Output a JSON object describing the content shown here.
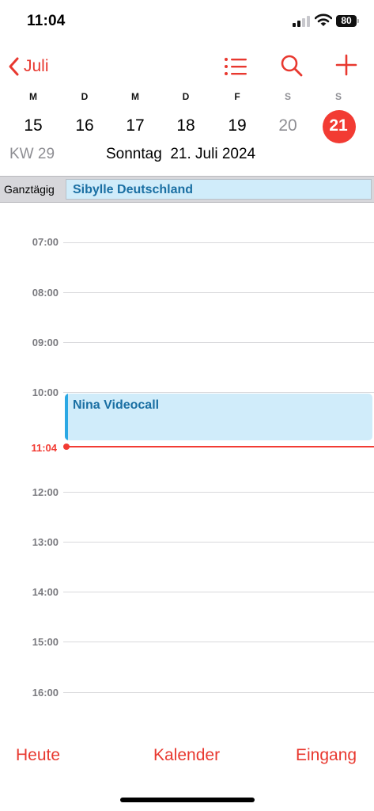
{
  "status_bar": {
    "time": "11:04",
    "battery": "80"
  },
  "nav": {
    "back_label": "Juli",
    "list_icon": "list-icon",
    "search_icon": "search-icon",
    "add_icon": "plus-icon"
  },
  "week": {
    "weekdays": [
      "M",
      "D",
      "M",
      "D",
      "F",
      "S",
      "S"
    ],
    "days": [
      "15",
      "16",
      "17",
      "18",
      "19",
      "20",
      "21"
    ],
    "selected_index": 6
  },
  "calendar_week": "KW 29",
  "selected_date": {
    "weekday": "Sonntag",
    "date": "21. Juli 2024"
  },
  "all_day": {
    "label": "Ganztägig",
    "event": "Sibylle Deutschland"
  },
  "hours": [
    "07:00",
    "08:00",
    "09:00",
    "10:00",
    "12:00",
    "13:00",
    "14:00",
    "15:00",
    "16:00"
  ],
  "current_time": "11:04",
  "events": [
    {
      "title": "Nina Videocall"
    }
  ],
  "colors": {
    "accent": "#f23b33",
    "event_fill": "#d0ecfa",
    "event_bar": "#2ba8e4",
    "event_text": "#1a6fa3"
  },
  "toolbar": {
    "today": "Heute",
    "calendars": "Kalender",
    "inbox": "Eingang"
  }
}
